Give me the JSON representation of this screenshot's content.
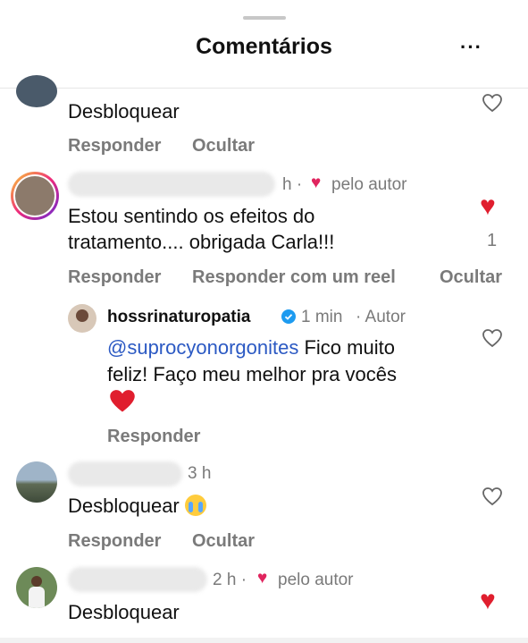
{
  "header": {
    "title": "Comentários",
    "more_label": "···"
  },
  "c0": {
    "text": "Desbloquear",
    "reply": "Responder",
    "hide": "Ocultar"
  },
  "c1": {
    "time": "h ·",
    "liked_by": "pelo autor",
    "text_line1": "Estou sentindo os efeitos do",
    "text_line2": "tratamento.... obrigada Carla!!!",
    "like_count": "1",
    "reply": "Responder",
    "reply_reel": "Responder com um reel",
    "hide": "Ocultar"
  },
  "r1": {
    "username": "hossrinaturopatia",
    "time": "1 min",
    "author_tag": "· Autor",
    "mention": "@suprocyonorgonites",
    "text_after_mention": " Fico muito",
    "text_line2": "feliz! Faço meu melhor pra vocês",
    "emoji": "❤️",
    "reply": "Responder"
  },
  "c2": {
    "time": "3 h",
    "text": "Desbloquear",
    "reply": "Responder",
    "hide": "Ocultar"
  },
  "c3": {
    "time": "2 h ·",
    "liked_by": "pelo autor",
    "text": "Desbloquear"
  },
  "colors": {
    "like_red": "#e01e2e",
    "mention_blue": "#2b59c3",
    "verified_blue": "#1d9bf0"
  }
}
